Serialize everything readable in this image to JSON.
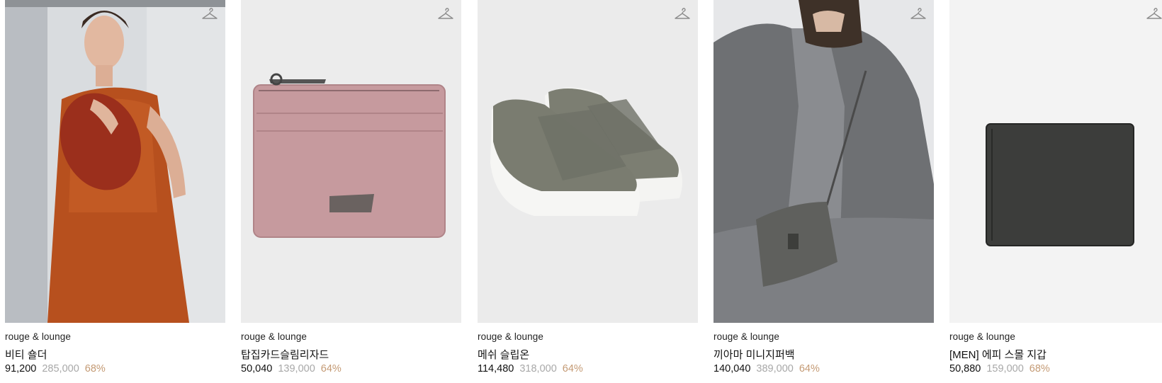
{
  "products": [
    {
      "brand": "rouge & lounge",
      "name": "비티 숄더",
      "sale_price": "91,200",
      "original_price": "285,000",
      "discount": "68%"
    },
    {
      "brand": "rouge & lounge",
      "name": "탑집카드슬림리자드",
      "sale_price": "50,040",
      "original_price": "139,000",
      "discount": "64%"
    },
    {
      "brand": "rouge & lounge",
      "name": "메쉬 슬립온",
      "sale_price": "114,480",
      "original_price": "318,000",
      "discount": "64%"
    },
    {
      "brand": "rouge & lounge",
      "name": "끼아마 미니지퍼백",
      "sale_price": "140,040",
      "original_price": "389,000",
      "discount": "64%"
    },
    {
      "brand": "rouge & lounge",
      "name": "[MEN] 에피 스몰 지갑",
      "sale_price": "50,880",
      "original_price": "159,000",
      "discount": "68%"
    }
  ],
  "icons": {
    "wishlist": "hanger-icon"
  },
  "colors": {
    "discount": "#c49a74",
    "original_price": "#a8a8a8",
    "text": "#111111"
  }
}
